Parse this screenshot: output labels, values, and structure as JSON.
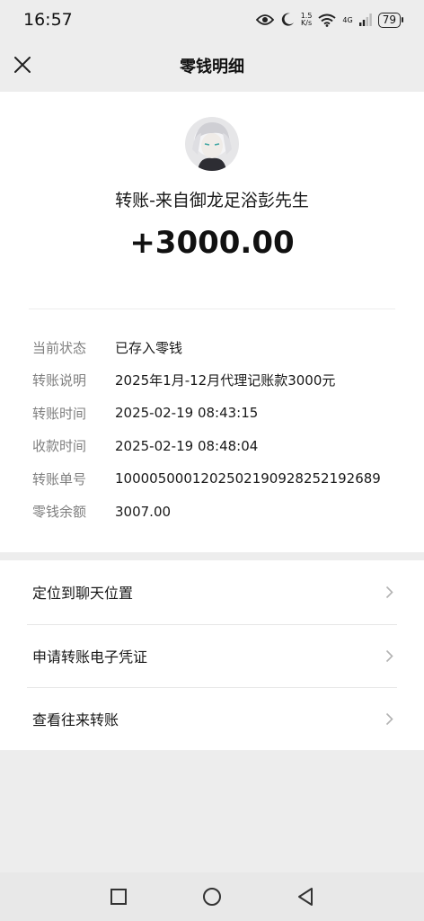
{
  "status_bar": {
    "time": "16:57",
    "speed_value": "1.5",
    "speed_unit": "K/s",
    "network": "4G",
    "battery": "79"
  },
  "nav": {
    "title": "零钱明细",
    "close_icon": "close-icon"
  },
  "transaction": {
    "title": "转账-来自御龙足浴彭先生",
    "amount": "+3000.00",
    "details": [
      {
        "label": "当前状态",
        "value": "已存入零钱"
      },
      {
        "label": "转账说明",
        "value": "2025年1月-12月代理记账款3000元"
      },
      {
        "label": "转账时间",
        "value": "2025-02-19 08:43:15"
      },
      {
        "label": "收款时间",
        "value": "2025-02-19 08:48:04"
      },
      {
        "label": "转账单号",
        "value": "1000050001202502190928252192689"
      },
      {
        "label": "零钱余额",
        "value": "3007.00"
      }
    ]
  },
  "menu": {
    "items": [
      {
        "label": "定位到聊天位置"
      },
      {
        "label": "申请转账电子凭证"
      },
      {
        "label": "查看往来转账"
      }
    ]
  },
  "colors": {
    "page_bg": "#ededed",
    "card_bg": "#ffffff",
    "label_gray": "#7f7f7f",
    "text_dark": "#191919"
  }
}
